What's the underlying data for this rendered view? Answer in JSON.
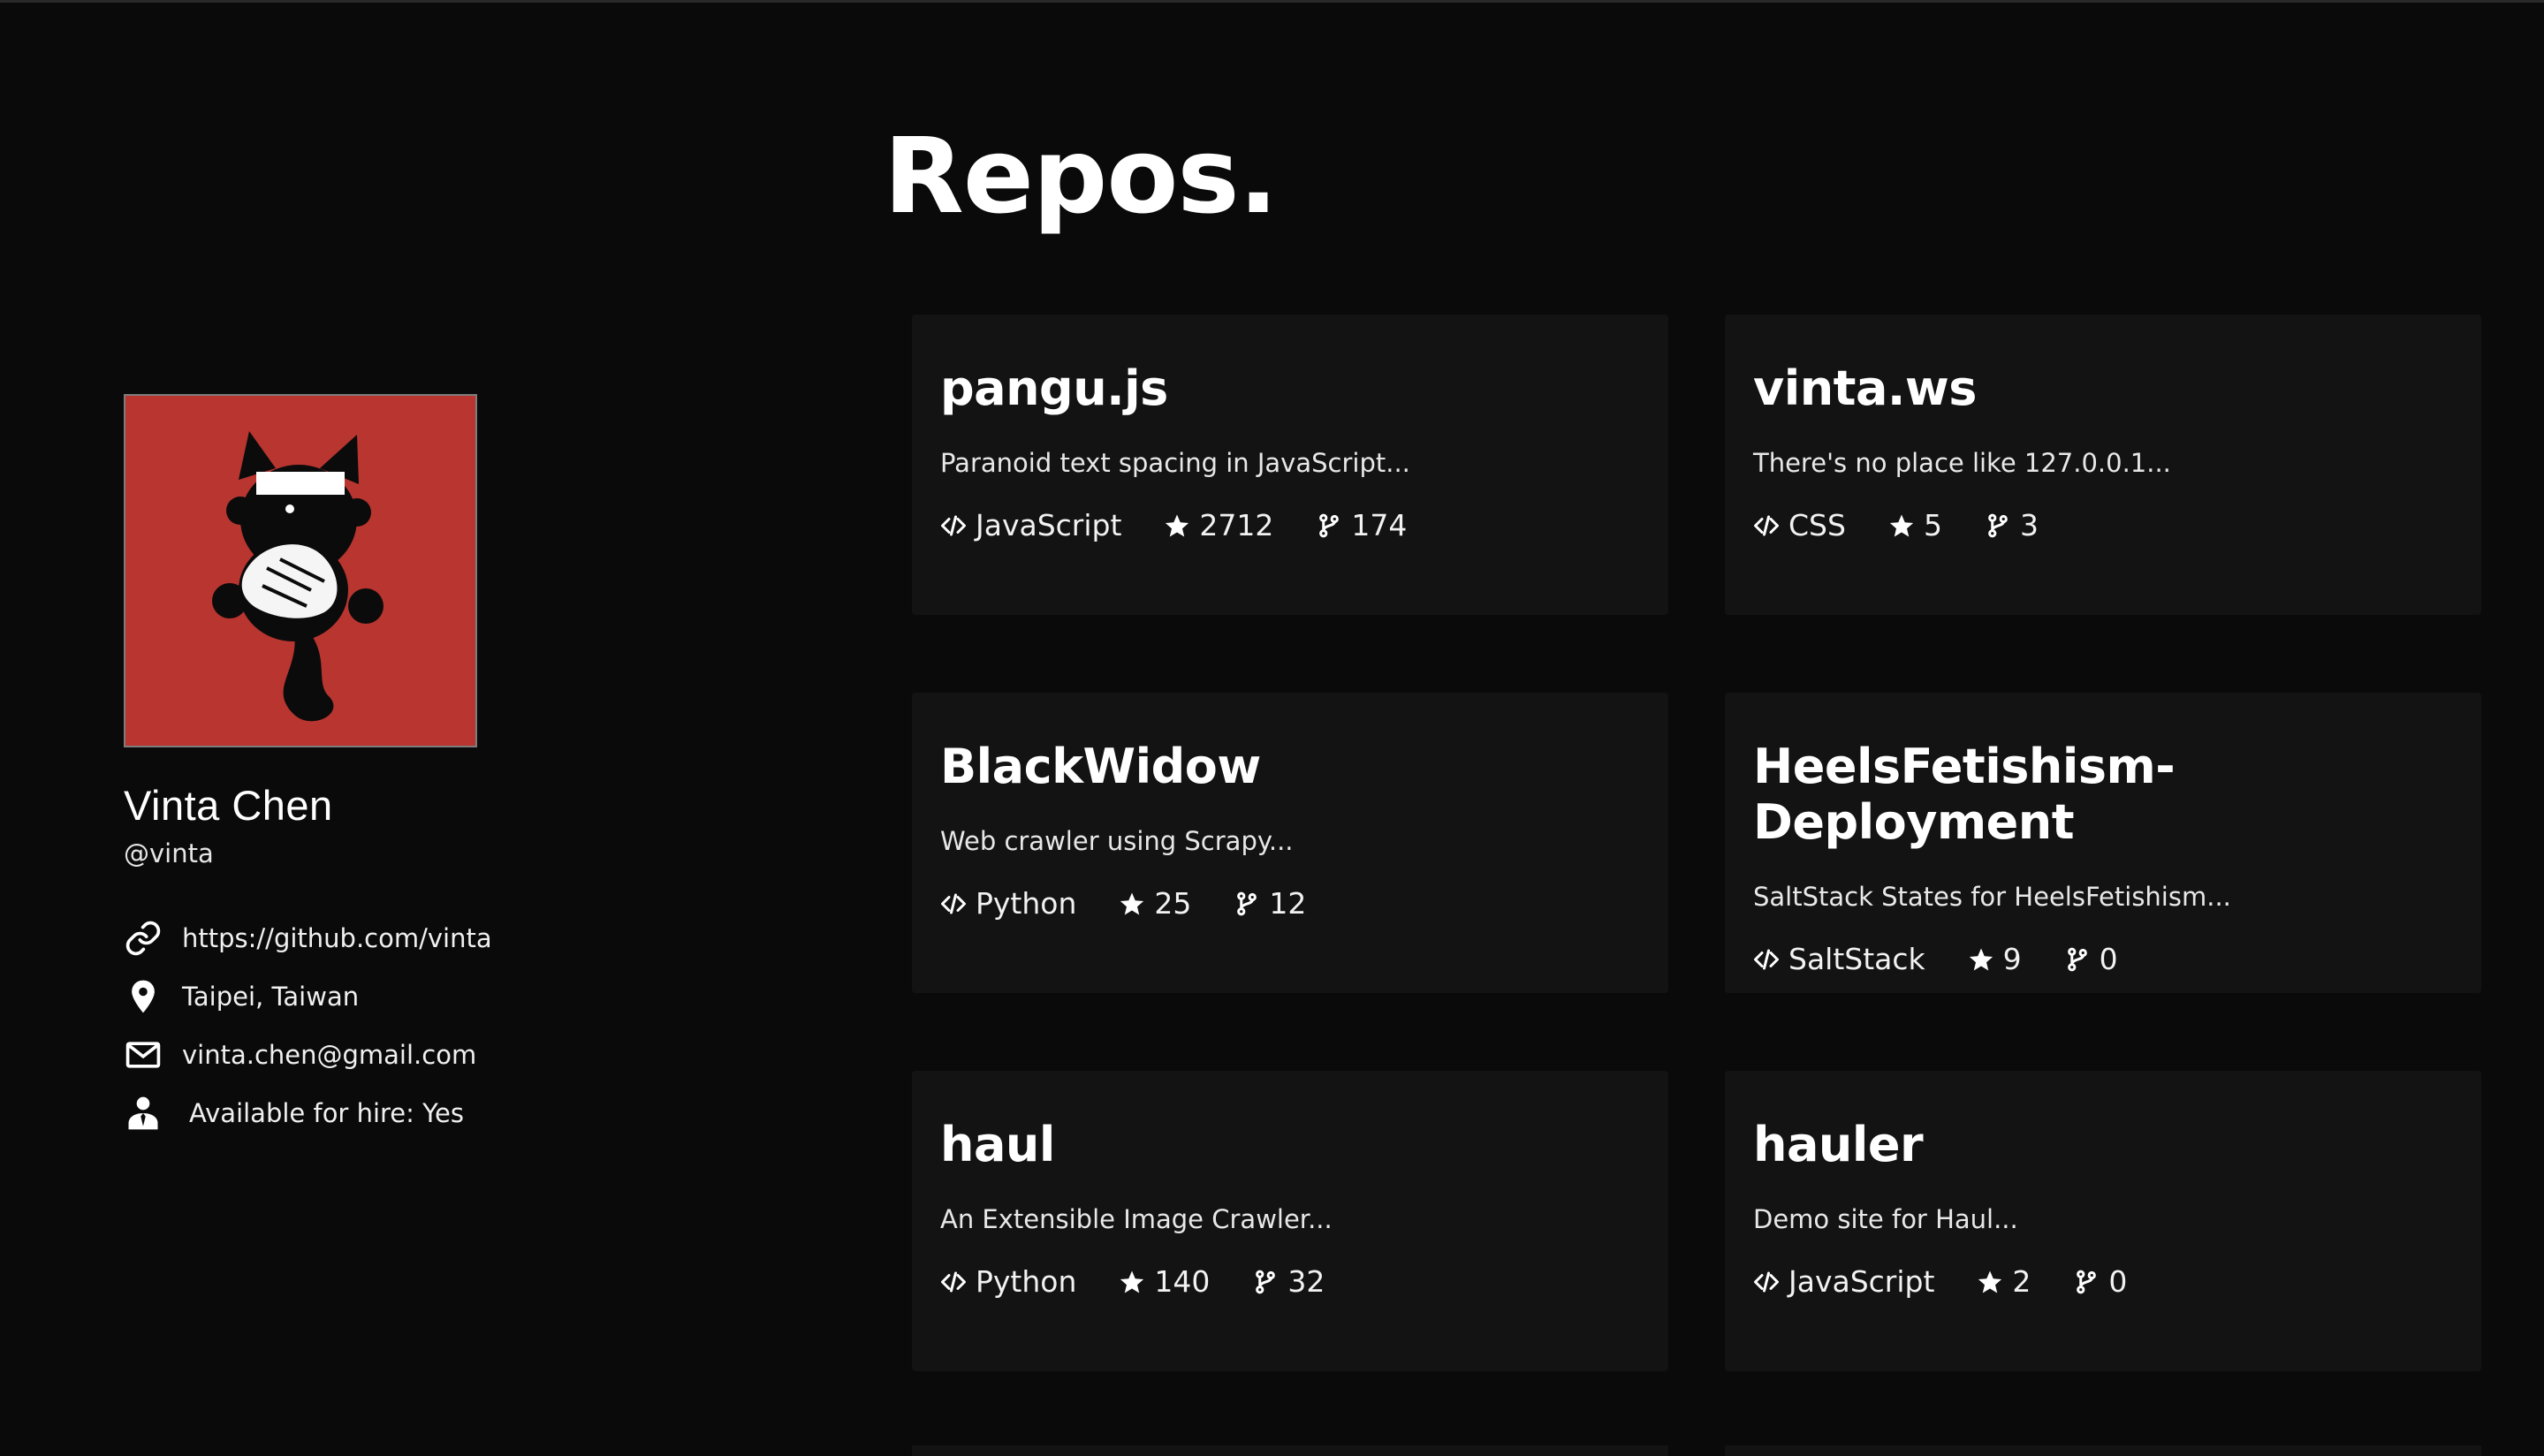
{
  "page": {
    "title": "Repos."
  },
  "profile": {
    "name": "Vinta Chen",
    "handle": "@vinta",
    "avatar_bg": "#b83530",
    "info": [
      {
        "icon": "link-icon",
        "text": "https://github.com/vinta"
      },
      {
        "icon": "location-pin-icon",
        "text": "Taipei, Taiwan"
      },
      {
        "icon": "mail-icon",
        "text": "vinta.chen@gmail.com"
      },
      {
        "icon": "person-tie-icon",
        "text": "Available for hire: Yes"
      }
    ]
  },
  "repos": [
    {
      "name": "pangu.js",
      "description": "Paranoid text spacing in JavaScript...",
      "language": "JavaScript",
      "stars": "2712",
      "forks": "174"
    },
    {
      "name": "vinta.ws",
      "description": "There's no place like 127.0.0.1...",
      "language": "CSS",
      "stars": "5",
      "forks": "3"
    },
    {
      "name": "BlackWidow",
      "description": "Web crawler using Scrapy...",
      "language": "Python",
      "stars": "25",
      "forks": "12"
    },
    {
      "name": "HeelsFetishism-Deployment",
      "description": "SaltStack States for HeelsFetishism...",
      "language": "SaltStack",
      "stars": "9",
      "forks": "0"
    },
    {
      "name": "haul",
      "description": "An Extensible Image Crawler...",
      "language": "Python",
      "stars": "140",
      "forks": "32"
    },
    {
      "name": "hauler",
      "description": "Demo site for Haul...",
      "language": "JavaScript",
      "stars": "2",
      "forks": "0"
    }
  ],
  "colors": {
    "background": "#0a0a0a",
    "card": "#131313",
    "text": "#ffffff"
  }
}
